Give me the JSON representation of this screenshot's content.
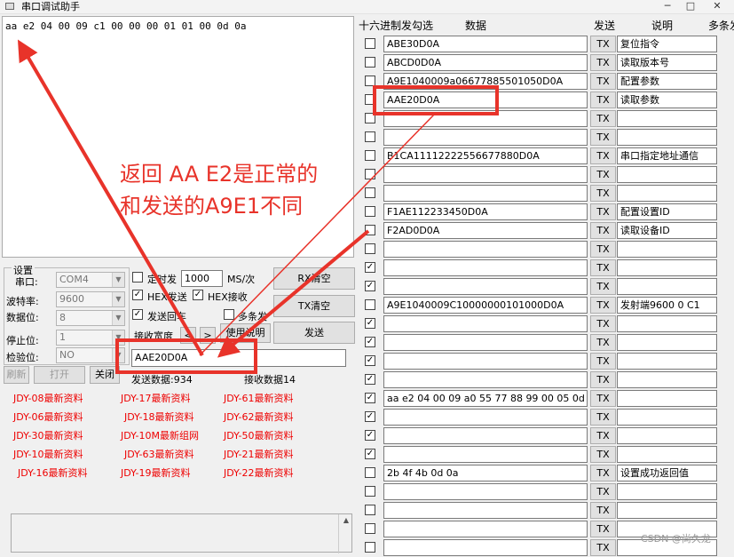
{
  "window": {
    "title": "串口调试助手"
  },
  "receive": {
    "text": "aa e2 04 00 09 c1 00 00 00 01 01 00 0d 0a"
  },
  "settings": {
    "legend": "设置",
    "port_label": "串口:",
    "port_value": "COM4",
    "baud_label": "波特率:",
    "baud_value": "9600",
    "databits_label": "数据位:",
    "databits_value": "8",
    "stopbits_label": "停止位:",
    "stopbits_value": "1",
    "parity_label": "检验位:",
    "parity_value": "NO",
    "refresh_label": "刷新",
    "open_label": "打开",
    "close_label": "关闭",
    "timed_send_label": "定时发",
    "timed_send_value": "1000",
    "ms_label": "MS/次",
    "hex_send_label": "HEX发送",
    "hex_recv_label": "HEX接收",
    "send_newline_label": "发送回车",
    "multi_send_label": "多条发",
    "recv_width_label": "接收宽度",
    "prev_label": "<",
    "next_label": ">",
    "help_label": "使用说明",
    "rx_clear_label": "RX清空",
    "tx_clear_label": "TX清空",
    "send_label": "发送",
    "send_input": "AAE20D0A",
    "sent_count": "发送数据:934",
    "recv_count": "接收数据14"
  },
  "links": [
    [
      "JDY-08最新资料",
      "JDY-17最新资料",
      "JDY-61最新资料"
    ],
    [
      "JDY-06最新资料",
      "JDY-18最新资料",
      "JDY-62最新资料"
    ],
    [
      "JDY-30最新资料",
      "JDY-10M最新组网",
      "JDY-50最新资料"
    ],
    [
      "JDY-10最新资料",
      "JDY-63最新资料",
      "JDY-21最新资料"
    ],
    [
      "JDY-16最新资料",
      "JDY-19最新资料",
      "JDY-22最新资料"
    ]
  ],
  "multi": {
    "headers": {
      "hex": "十六进制发勾选",
      "data": "数据",
      "send": "发送",
      "desc": "说明",
      "multi": "多条发"
    },
    "tx_label": "TX",
    "rows": [
      {
        "checked": false,
        "data": "ABE30D0A",
        "desc": "复位指令"
      },
      {
        "checked": false,
        "data": "ABCD0D0A",
        "desc": "读取版本号"
      },
      {
        "checked": false,
        "data": "A9E1040009a06677885501050D0A",
        "desc": "配置参数"
      },
      {
        "checked": false,
        "data": "AAE20D0A",
        "desc": "读取参数"
      },
      {
        "checked": false,
        "data": "",
        "desc": ""
      },
      {
        "checked": false,
        "data": "",
        "desc": ""
      },
      {
        "checked": false,
        "data": "B1CA11112222556677880D0A",
        "desc": "串口指定地址通信"
      },
      {
        "checked": false,
        "data": "",
        "desc": ""
      },
      {
        "checked": false,
        "data": "",
        "desc": ""
      },
      {
        "checked": false,
        "data": "F1AE112233450D0A",
        "desc": "配置设置ID"
      },
      {
        "checked": false,
        "data": "F2AD0D0A",
        "desc": "读取设备ID"
      },
      {
        "checked": false,
        "data": "",
        "desc": ""
      },
      {
        "checked": true,
        "data": "",
        "desc": ""
      },
      {
        "checked": true,
        "data": "",
        "desc": ""
      },
      {
        "checked": false,
        "data": "A9E1040009C10000000101000D0A",
        "desc": "发射端9600 0 C1"
      },
      {
        "checked": true,
        "data": "",
        "desc": ""
      },
      {
        "checked": true,
        "data": "",
        "desc": ""
      },
      {
        "checked": true,
        "data": "",
        "desc": ""
      },
      {
        "checked": true,
        "data": "",
        "desc": ""
      },
      {
        "checked": true,
        "data": "aa e2 04 00 09 a0 55 77 88 99 00 05 0d",
        "desc": ""
      },
      {
        "checked": true,
        "data": "",
        "desc": ""
      },
      {
        "checked": true,
        "data": "",
        "desc": ""
      },
      {
        "checked": true,
        "data": "",
        "desc": ""
      },
      {
        "checked": false,
        "data": "2b 4f 4b 0d 0a",
        "desc": "设置成功返回值"
      },
      {
        "checked": false,
        "data": "",
        "desc": ""
      },
      {
        "checked": false,
        "data": "",
        "desc": ""
      },
      {
        "checked": false,
        "data": "",
        "desc": ""
      },
      {
        "checked": false,
        "data": "",
        "desc": ""
      }
    ]
  },
  "annotation": {
    "line1": "返回 AA E2是正常的",
    "line2": "和发送的A9E1不同"
  },
  "watermark": "CSDN @尚久龙",
  "colors": {
    "annotation": "#e8332a",
    "link": "#e00000"
  }
}
